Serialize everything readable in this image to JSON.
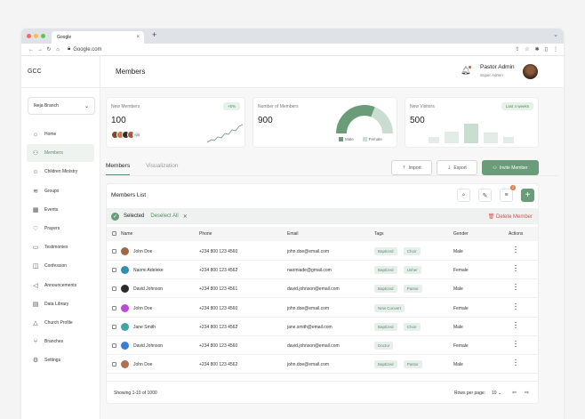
{
  "browser": {
    "tab_title": "Google",
    "url": "Google.com",
    "close_glyph": "×",
    "new_tab_glyph": "+"
  },
  "sidebar": {
    "logo": "GCC",
    "branch_select": "Ikeja Branch",
    "items": [
      {
        "label": "Home",
        "icon": "home-icon",
        "active": false
      },
      {
        "label": "Members",
        "icon": "users-icon",
        "active": true
      },
      {
        "label": "Children Ministry",
        "icon": "child-icon",
        "active": false
      },
      {
        "label": "Groups",
        "icon": "groups-icon",
        "active": false
      },
      {
        "label": "Events",
        "icon": "calendar-icon",
        "active": false
      },
      {
        "label": "Prayers",
        "icon": "heart-icon",
        "active": false
      },
      {
        "label": "Testimonies",
        "icon": "message-icon",
        "active": false
      },
      {
        "label": "Confession",
        "icon": "book-icon",
        "active": false
      },
      {
        "label": "Announcements",
        "icon": "megaphone-icon",
        "active": false
      },
      {
        "label": "Data Library",
        "icon": "database-icon",
        "active": false
      },
      {
        "label": "Church Profile",
        "icon": "church-icon",
        "active": false
      },
      {
        "label": "Branches",
        "icon": "branch-icon",
        "active": false
      },
      {
        "label": "Settings",
        "icon": "gear-icon",
        "active": false
      }
    ]
  },
  "header": {
    "title": "Members",
    "user_name": "Pastor Admin",
    "user_role": "Super Admin"
  },
  "stats": {
    "new_members": {
      "label": "New Members",
      "value": "100",
      "change": "+5%",
      "more_avatars": "+20"
    },
    "number_of_members": {
      "label": "Number of Members",
      "value": "900",
      "legend_male": "Male",
      "legend_female": "Female",
      "male_fraction": 0.62
    },
    "new_visitors": {
      "label": "New Visitors",
      "value": "500",
      "period": "Last 4 weeks"
    }
  },
  "tabs": [
    "Members",
    "Visualization"
  ],
  "actions": {
    "import": "Import",
    "export": "Export",
    "invite": "Invite Member"
  },
  "list": {
    "title": "Members List",
    "filter_badge": "2",
    "selected_label": "Selected",
    "deselect_label": "Deselect All",
    "delete_label": "Delete Member",
    "columns": [
      "Name",
      "Phone",
      "Email",
      "Tags",
      "Gender",
      "Actions"
    ],
    "rows": [
      {
        "name": "John Doe",
        "phone": "+234 800 123 4560",
        "email": "john.doe@email.com",
        "tags": [
          "Baptized",
          "Choir"
        ],
        "gender": "Male",
        "avatar_color": "#a06848"
      },
      {
        "name": "Naomi Adeleke",
        "phone": "+234 800 123 4562",
        "email": "naomiade@gmail.com",
        "tags": [
          "Baptized",
          "Usher"
        ],
        "gender": "Female",
        "avatar_color": "#2f8fb0"
      },
      {
        "name": "David Johnson",
        "phone": "+234 800 123 4561",
        "email": "david.johnson@email.com",
        "tags": [
          "Baptized",
          "Pastor"
        ],
        "gender": "Male",
        "avatar_color": "#2b2b2b"
      },
      {
        "name": "John Doe",
        "phone": "+234 800 123 4560",
        "email": "john.doe@email.com",
        "tags": [
          "New Convert"
        ],
        "gender": "Female",
        "avatar_color": "#b84fd0"
      },
      {
        "name": "Jane Smith",
        "phone": "+234 800 123 4562",
        "email": "jane.smith@email.com",
        "tags": [
          "Baptized",
          "Choir"
        ],
        "gender": "Male",
        "avatar_color": "#3fa7a0"
      },
      {
        "name": "David Johnson",
        "phone": "+234 800 123 4560",
        "email": "david.johnson@email.com",
        "tags": [
          "Doctor"
        ],
        "gender": "Female",
        "avatar_color": "#3a7fd0"
      },
      {
        "name": "John Doe",
        "phone": "+234 800 123 4562",
        "email": "john.doe@email.com",
        "tags": [
          "Baptized",
          "Pastor"
        ],
        "gender": "Male",
        "avatar_color": "#b07050"
      }
    ],
    "showing": "Showing 1-10 of 1000",
    "rows_per_page_label": "Rows per page:",
    "rows_per_page_value": "10"
  },
  "colors": {
    "accent": "#6b9c7a",
    "accent_light": "#c9ddd0",
    "danger": "#d9534f"
  }
}
